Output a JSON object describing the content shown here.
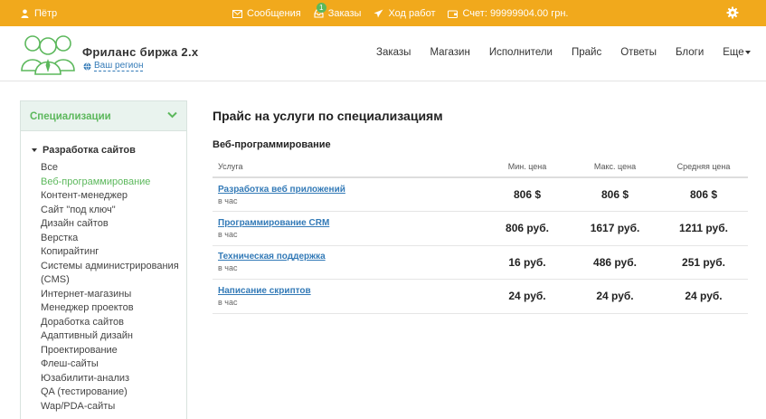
{
  "topbar": {
    "user_name": "Пётр",
    "messages_label": "Сообщения",
    "orders_label": "Заказы",
    "orders_badge": "1",
    "progress_label": "Ход работ",
    "balance_label": "Счет: 99999904.00 грн."
  },
  "header": {
    "brand": "Фриланс биржа 2.х",
    "region_link": "Ваш регион",
    "nav": [
      "Заказы",
      "Магазин",
      "Исполнители",
      "Прайс",
      "Ответы",
      "Блоги",
      "Еще"
    ]
  },
  "sidebar": {
    "title": "Специализации",
    "group": "Разработка сайтов",
    "items": [
      "Все",
      "Веб-программирование",
      "Контент-менеджер",
      "Сайт \"под ключ\"",
      "Дизайн сайтов",
      "Верстка",
      "Копирайтинг",
      "Системы администрирования (CMS)",
      "Интернет-магазины",
      "Менеджер проектов",
      "Доработка сайтов",
      "Адаптивный дизайн",
      "Проектирование",
      "Флеш-сайты",
      "Юзабилити-анализ",
      "QA (тестирование)",
      "Wap/PDA-сайты"
    ],
    "active_index": 1
  },
  "main": {
    "page_title": "Прайс на услуги по специализациям",
    "section_title": "Веб-программирование",
    "columns": [
      "Услуга",
      "Мин. цена",
      "Макс. цена",
      "Средняя цена"
    ],
    "rows": [
      {
        "service": "Разработка веб приложений",
        "unit": "в час",
        "min": "806 $",
        "max": "806 $",
        "avg": "806 $"
      },
      {
        "service": "Программирование CRM",
        "unit": "в час",
        "min": "806 руб.",
        "max": "1617 руб.",
        "avg": "1211 руб."
      },
      {
        "service": "Техническая поддержка",
        "unit": "в час",
        "min": "16 руб.",
        "max": "486 руб.",
        "avg": "251 руб."
      },
      {
        "service": "Написание скриптов",
        "unit": "в час",
        "min": "24 руб.",
        "max": "24 руб.",
        "avg": "24 руб."
      }
    ]
  },
  "colors": {
    "accent_orange": "#f1a91c",
    "accent_green": "#5cb85c",
    "link_blue": "#337ab7"
  },
  "icons": [
    "user-icon",
    "envelope-icon",
    "inbox-icon",
    "plane-icon",
    "wallet-icon",
    "gear-icon",
    "globe-icon",
    "chevron-down-icon"
  ]
}
